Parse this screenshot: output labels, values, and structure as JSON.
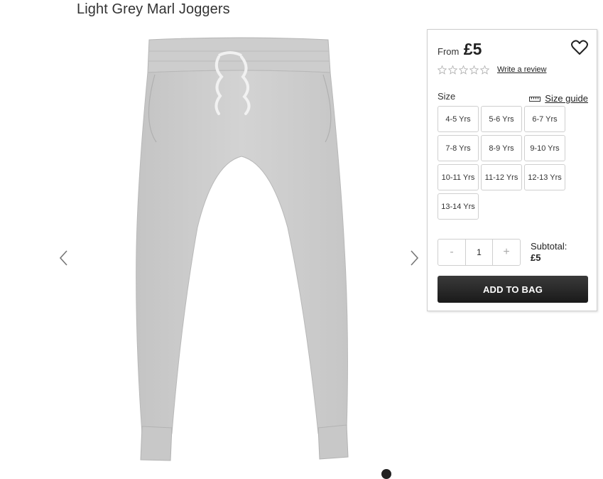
{
  "product": {
    "title": "Light Grey Marl Joggers"
  },
  "gallery": {
    "prev_icon": "chevron-left-icon",
    "next_icon": "chevron-right-icon"
  },
  "buy_panel": {
    "from_label": "From",
    "price": "£5",
    "wishlist_icon": "heart-icon",
    "rating": 0,
    "review_link": "Write a review",
    "size_label": "Size",
    "size_guide": "Size guide",
    "sizes": [
      "4-5 Yrs",
      "5-6 Yrs",
      "6-7 Yrs",
      "7-8 Yrs",
      "8-9 Yrs",
      "9-10 Yrs",
      "10-11 Yrs",
      "11-12 Yrs",
      "12-13 Yrs",
      "13-14 Yrs"
    ],
    "quantity": {
      "minus": "-",
      "value": "1",
      "plus": "+"
    },
    "subtotal_label": "Subtotal:",
    "subtotal_value": "£5",
    "add_to_bag": "ADD TO BAG"
  }
}
